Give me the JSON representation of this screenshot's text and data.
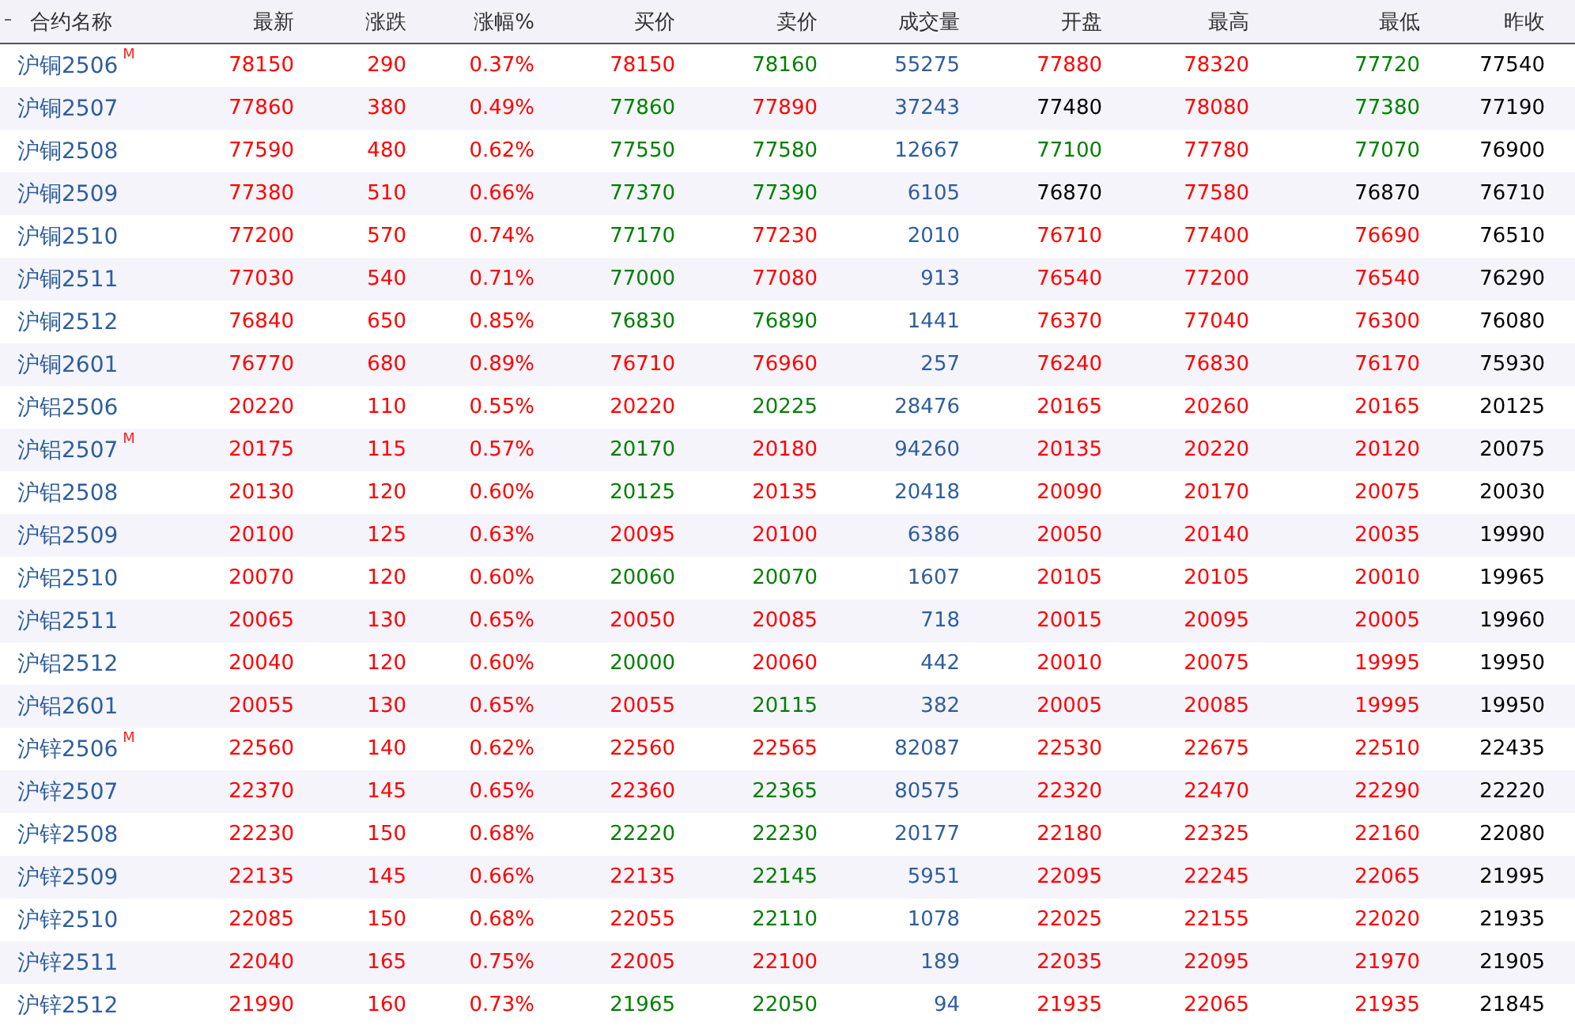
{
  "columns": [
    {
      "label": "合约名称",
      "kind": "name"
    },
    {
      "label": "最新",
      "kind": "price"
    },
    {
      "label": "涨跌",
      "kind": "price"
    },
    {
      "label": "涨幅%",
      "kind": "price"
    },
    {
      "label": "买价",
      "kind": "price"
    },
    {
      "label": "卖价",
      "kind": "price"
    },
    {
      "label": "成交量",
      "kind": "volume"
    },
    {
      "label": "开盘",
      "kind": "price"
    },
    {
      "label": "最高",
      "kind": "price"
    },
    {
      "label": "最低",
      "kind": "price"
    },
    {
      "label": "昨收",
      "kind": "close"
    }
  ],
  "rows": [
    {
      "name": "沪铜2506",
      "flag": "M",
      "cells": [
        {
          "text": "78150",
          "color": "#ff0000"
        },
        {
          "text": "290",
          "color": "#ff0000"
        },
        {
          "text": "0.37%",
          "color": "#ff0000"
        },
        {
          "text": "78150",
          "color": "#ff0000"
        },
        {
          "text": "78160",
          "color": "#008000"
        },
        {
          "text": "55275"
        },
        {
          "text": "77880",
          "color": "#ff0000"
        },
        {
          "text": "78320",
          "color": "#ff0000"
        },
        {
          "text": "77720",
          "color": "#008000"
        },
        {
          "text": "77540"
        }
      ]
    },
    {
      "name": "沪铜2507",
      "cells": [
        {
          "text": "77860",
          "color": "#ff0000"
        },
        {
          "text": "380",
          "color": "#ff0000"
        },
        {
          "text": "0.49%",
          "color": "#ff0000"
        },
        {
          "text": "77860",
          "color": "#008000"
        },
        {
          "text": "77890",
          "color": "#ff0000"
        },
        {
          "text": "37243"
        },
        {
          "text": "77480",
          "color": "#000000"
        },
        {
          "text": "78080",
          "color": "#ff0000"
        },
        {
          "text": "77380",
          "color": "#008000"
        },
        {
          "text": "77190"
        }
      ]
    },
    {
      "name": "沪铜2508",
      "cells": [
        {
          "text": "77590",
          "color": "#ff0000"
        },
        {
          "text": "480",
          "color": "#ff0000"
        },
        {
          "text": "0.62%",
          "color": "#ff0000"
        },
        {
          "text": "77550",
          "color": "#008000"
        },
        {
          "text": "77580",
          "color": "#008000"
        },
        {
          "text": "12667"
        },
        {
          "text": "77100",
          "color": "#008000"
        },
        {
          "text": "77780",
          "color": "#ff0000"
        },
        {
          "text": "77070",
          "color": "#008000"
        },
        {
          "text": "76900"
        }
      ]
    },
    {
      "name": "沪铜2509",
      "cells": [
        {
          "text": "77380",
          "color": "#ff0000"
        },
        {
          "text": "510",
          "color": "#ff0000"
        },
        {
          "text": "0.66%",
          "color": "#ff0000"
        },
        {
          "text": "77370",
          "color": "#008000"
        },
        {
          "text": "77390",
          "color": "#008000"
        },
        {
          "text": "6105"
        },
        {
          "text": "76870",
          "color": "#000000"
        },
        {
          "text": "77580",
          "color": "#ff0000"
        },
        {
          "text": "76870",
          "color": "#000000"
        },
        {
          "text": "76710"
        }
      ]
    },
    {
      "name": "沪铜2510",
      "cells": [
        {
          "text": "77200",
          "color": "#ff0000"
        },
        {
          "text": "570",
          "color": "#ff0000"
        },
        {
          "text": "0.74%",
          "color": "#ff0000"
        },
        {
          "text": "77170",
          "color": "#008000"
        },
        {
          "text": "77230",
          "color": "#ff0000"
        },
        {
          "text": "2010"
        },
        {
          "text": "76710",
          "color": "#ff0000"
        },
        {
          "text": "77400",
          "color": "#ff0000"
        },
        {
          "text": "76690",
          "color": "#ff0000"
        },
        {
          "text": "76510"
        }
      ]
    },
    {
      "name": "沪铜2511",
      "cells": [
        {
          "text": "77030",
          "color": "#ff0000"
        },
        {
          "text": "540",
          "color": "#ff0000"
        },
        {
          "text": "0.71%",
          "color": "#ff0000"
        },
        {
          "text": "77000",
          "color": "#008000"
        },
        {
          "text": "77080",
          "color": "#ff0000"
        },
        {
          "text": "913"
        },
        {
          "text": "76540",
          "color": "#ff0000"
        },
        {
          "text": "77200",
          "color": "#ff0000"
        },
        {
          "text": "76540",
          "color": "#ff0000"
        },
        {
          "text": "76290"
        }
      ]
    },
    {
      "name": "沪铜2512",
      "cells": [
        {
          "text": "76840",
          "color": "#ff0000"
        },
        {
          "text": "650",
          "color": "#ff0000"
        },
        {
          "text": "0.85%",
          "color": "#ff0000"
        },
        {
          "text": "76830",
          "color": "#008000"
        },
        {
          "text": "76890",
          "color": "#008000"
        },
        {
          "text": "1441"
        },
        {
          "text": "76370",
          "color": "#ff0000"
        },
        {
          "text": "77040",
          "color": "#ff0000"
        },
        {
          "text": "76300",
          "color": "#ff0000"
        },
        {
          "text": "76080"
        }
      ]
    },
    {
      "name": "沪铜2601",
      "cells": [
        {
          "text": "76770",
          "color": "#ff0000"
        },
        {
          "text": "680",
          "color": "#ff0000"
        },
        {
          "text": "0.89%",
          "color": "#ff0000"
        },
        {
          "text": "76710",
          "color": "#ff0000"
        },
        {
          "text": "76960",
          "color": "#ff0000"
        },
        {
          "text": "257"
        },
        {
          "text": "76240",
          "color": "#ff0000"
        },
        {
          "text": "76830",
          "color": "#ff0000"
        },
        {
          "text": "76170",
          "color": "#ff0000"
        },
        {
          "text": "75930"
        }
      ]
    },
    {
      "name": "沪铝2506",
      "cells": [
        {
          "text": "20220",
          "color": "#ff0000"
        },
        {
          "text": "110",
          "color": "#ff0000"
        },
        {
          "text": "0.55%",
          "color": "#ff0000"
        },
        {
          "text": "20220",
          "color": "#ff0000"
        },
        {
          "text": "20225",
          "color": "#008000"
        },
        {
          "text": "28476"
        },
        {
          "text": "20165",
          "color": "#ff0000"
        },
        {
          "text": "20260",
          "color": "#ff0000"
        },
        {
          "text": "20165",
          "color": "#ff0000"
        },
        {
          "text": "20125"
        }
      ]
    },
    {
      "name": "沪铝2507",
      "flag": "M",
      "cells": [
        {
          "text": "20175",
          "color": "#ff0000"
        },
        {
          "text": "115",
          "color": "#ff0000"
        },
        {
          "text": "0.57%",
          "color": "#ff0000"
        },
        {
          "text": "20170",
          "color": "#008000"
        },
        {
          "text": "20180",
          "color": "#ff0000"
        },
        {
          "text": "94260"
        },
        {
          "text": "20135",
          "color": "#ff0000"
        },
        {
          "text": "20220",
          "color": "#ff0000"
        },
        {
          "text": "20120",
          "color": "#ff0000"
        },
        {
          "text": "20075"
        }
      ]
    },
    {
      "name": "沪铝2508",
      "cells": [
        {
          "text": "20130",
          "color": "#ff0000"
        },
        {
          "text": "120",
          "color": "#ff0000"
        },
        {
          "text": "0.60%",
          "color": "#ff0000"
        },
        {
          "text": "20125",
          "color": "#008000"
        },
        {
          "text": "20135",
          "color": "#ff0000"
        },
        {
          "text": "20418"
        },
        {
          "text": "20090",
          "color": "#ff0000"
        },
        {
          "text": "20170",
          "color": "#ff0000"
        },
        {
          "text": "20075",
          "color": "#ff0000"
        },
        {
          "text": "20030"
        }
      ]
    },
    {
      "name": "沪铝2509",
      "cells": [
        {
          "text": "20100",
          "color": "#ff0000"
        },
        {
          "text": "125",
          "color": "#ff0000"
        },
        {
          "text": "0.63%",
          "color": "#ff0000"
        },
        {
          "text": "20095",
          "color": "#ff0000"
        },
        {
          "text": "20100",
          "color": "#ff0000"
        },
        {
          "text": "6386"
        },
        {
          "text": "20050",
          "color": "#ff0000"
        },
        {
          "text": "20140",
          "color": "#ff0000"
        },
        {
          "text": "20035",
          "color": "#ff0000"
        },
        {
          "text": "19990"
        }
      ]
    },
    {
      "name": "沪铝2510",
      "cells": [
        {
          "text": "20070",
          "color": "#ff0000"
        },
        {
          "text": "120",
          "color": "#ff0000"
        },
        {
          "text": "0.60%",
          "color": "#ff0000"
        },
        {
          "text": "20060",
          "color": "#008000"
        },
        {
          "text": "20070",
          "color": "#008000"
        },
        {
          "text": "1607"
        },
        {
          "text": "20105",
          "color": "#ff0000"
        },
        {
          "text": "20105",
          "color": "#ff0000"
        },
        {
          "text": "20010",
          "color": "#ff0000"
        },
        {
          "text": "19965"
        }
      ]
    },
    {
      "name": "沪铝2511",
      "cells": [
        {
          "text": "20065",
          "color": "#ff0000"
        },
        {
          "text": "130",
          "color": "#ff0000"
        },
        {
          "text": "0.65%",
          "color": "#ff0000"
        },
        {
          "text": "20050",
          "color": "#ff0000"
        },
        {
          "text": "20085",
          "color": "#ff0000"
        },
        {
          "text": "718"
        },
        {
          "text": "20015",
          "color": "#ff0000"
        },
        {
          "text": "20095",
          "color": "#ff0000"
        },
        {
          "text": "20005",
          "color": "#ff0000"
        },
        {
          "text": "19960"
        }
      ]
    },
    {
      "name": "沪铝2512",
      "cells": [
        {
          "text": "20040",
          "color": "#ff0000"
        },
        {
          "text": "120",
          "color": "#ff0000"
        },
        {
          "text": "0.60%",
          "color": "#ff0000"
        },
        {
          "text": "20000",
          "color": "#008000"
        },
        {
          "text": "20060",
          "color": "#ff0000"
        },
        {
          "text": "442"
        },
        {
          "text": "20010",
          "color": "#ff0000"
        },
        {
          "text": "20075",
          "color": "#ff0000"
        },
        {
          "text": "19995",
          "color": "#ff0000"
        },
        {
          "text": "19950"
        }
      ]
    },
    {
      "name": "沪铝2601",
      "cells": [
        {
          "text": "20055",
          "color": "#ff0000"
        },
        {
          "text": "130",
          "color": "#ff0000"
        },
        {
          "text": "0.65%",
          "color": "#ff0000"
        },
        {
          "text": "20055",
          "color": "#ff0000"
        },
        {
          "text": "20115",
          "color": "#008000"
        },
        {
          "text": "382"
        },
        {
          "text": "20005",
          "color": "#ff0000"
        },
        {
          "text": "20085",
          "color": "#ff0000"
        },
        {
          "text": "19995",
          "color": "#ff0000"
        },
        {
          "text": "19950"
        }
      ]
    },
    {
      "name": "沪锌2506",
      "flag": "M",
      "cells": [
        {
          "text": "22560",
          "color": "#ff0000"
        },
        {
          "text": "140",
          "color": "#ff0000"
        },
        {
          "text": "0.62%",
          "color": "#ff0000"
        },
        {
          "text": "22560",
          "color": "#ff0000"
        },
        {
          "text": "22565",
          "color": "#ff0000"
        },
        {
          "text": "82087"
        },
        {
          "text": "22530",
          "color": "#ff0000"
        },
        {
          "text": "22675",
          "color": "#ff0000"
        },
        {
          "text": "22510",
          "color": "#ff0000"
        },
        {
          "text": "22435"
        }
      ]
    },
    {
      "name": "沪锌2507",
      "cells": [
        {
          "text": "22370",
          "color": "#ff0000"
        },
        {
          "text": "145",
          "color": "#ff0000"
        },
        {
          "text": "0.65%",
          "color": "#ff0000"
        },
        {
          "text": "22360",
          "color": "#ff0000"
        },
        {
          "text": "22365",
          "color": "#008000"
        },
        {
          "text": "80575"
        },
        {
          "text": "22320",
          "color": "#ff0000"
        },
        {
          "text": "22470",
          "color": "#ff0000"
        },
        {
          "text": "22290",
          "color": "#ff0000"
        },
        {
          "text": "22220"
        }
      ]
    },
    {
      "name": "沪锌2508",
      "cells": [
        {
          "text": "22230",
          "color": "#ff0000"
        },
        {
          "text": "150",
          "color": "#ff0000"
        },
        {
          "text": "0.68%",
          "color": "#ff0000"
        },
        {
          "text": "22220",
          "color": "#008000"
        },
        {
          "text": "22230",
          "color": "#008000"
        },
        {
          "text": "20177"
        },
        {
          "text": "22180",
          "color": "#ff0000"
        },
        {
          "text": "22325",
          "color": "#ff0000"
        },
        {
          "text": "22160",
          "color": "#ff0000"
        },
        {
          "text": "22080"
        }
      ]
    },
    {
      "name": "沪锌2509",
      "cells": [
        {
          "text": "22135",
          "color": "#ff0000"
        },
        {
          "text": "145",
          "color": "#ff0000"
        },
        {
          "text": "0.66%",
          "color": "#ff0000"
        },
        {
          "text": "22135",
          "color": "#ff0000"
        },
        {
          "text": "22145",
          "color": "#008000"
        },
        {
          "text": "5951"
        },
        {
          "text": "22095",
          "color": "#ff0000"
        },
        {
          "text": "22245",
          "color": "#ff0000"
        },
        {
          "text": "22065",
          "color": "#ff0000"
        },
        {
          "text": "21995"
        }
      ]
    },
    {
      "name": "沪锌2510",
      "cells": [
        {
          "text": "22085",
          "color": "#ff0000"
        },
        {
          "text": "150",
          "color": "#ff0000"
        },
        {
          "text": "0.68%",
          "color": "#ff0000"
        },
        {
          "text": "22055",
          "color": "#ff0000"
        },
        {
          "text": "22110",
          "color": "#008000"
        },
        {
          "text": "1078"
        },
        {
          "text": "22025",
          "color": "#ff0000"
        },
        {
          "text": "22155",
          "color": "#ff0000"
        },
        {
          "text": "22020",
          "color": "#ff0000"
        },
        {
          "text": "21935"
        }
      ]
    },
    {
      "name": "沪锌2511",
      "cells": [
        {
          "text": "22040",
          "color": "#ff0000"
        },
        {
          "text": "165",
          "color": "#ff0000"
        },
        {
          "text": "0.75%",
          "color": "#ff0000"
        },
        {
          "text": "22005",
          "color": "#ff0000"
        },
        {
          "text": "22100",
          "color": "#ff0000"
        },
        {
          "text": "189"
        },
        {
          "text": "22035",
          "color": "#ff0000"
        },
        {
          "text": "22095",
          "color": "#ff0000"
        },
        {
          "text": "21970",
          "color": "#ff0000"
        },
        {
          "text": "21905"
        }
      ]
    },
    {
      "name": "沪锌2512",
      "cells": [
        {
          "text": "21990",
          "color": "#ff0000"
        },
        {
          "text": "160",
          "color": "#ff0000"
        },
        {
          "text": "0.73%",
          "color": "#ff0000"
        },
        {
          "text": "21965",
          "color": "#008000"
        },
        {
          "text": "22050",
          "color": "#008000"
        },
        {
          "text": "94"
        },
        {
          "text": "21935",
          "color": "#ff0000"
        },
        {
          "text": "22065",
          "color": "#ff0000"
        },
        {
          "text": "21935",
          "color": "#ff0000"
        },
        {
          "text": "21845"
        }
      ]
    }
  ]
}
